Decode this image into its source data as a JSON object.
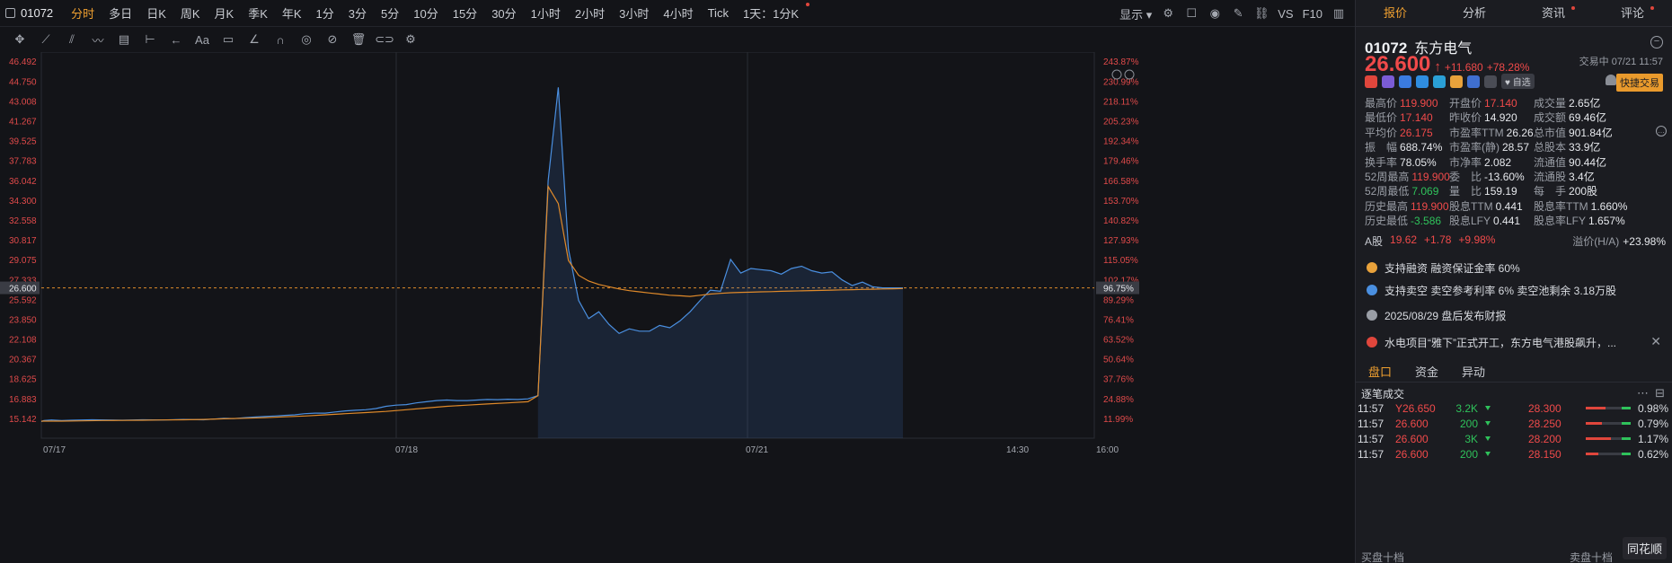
{
  "topbar": {
    "code": "01072",
    "timeframes": [
      "分时",
      "多日",
      "日K",
      "周K",
      "月K",
      "季K",
      "年K",
      "1分",
      "3分",
      "5分",
      "10分",
      "15分",
      "30分",
      "1小时",
      "2小时",
      "3小时",
      "4小时",
      "Tick",
      "1天：1分K"
    ],
    "active_index": 0,
    "display_label": "显示",
    "vs_label": "VS",
    "f10_label": "F10"
  },
  "chart_data": {
    "type": "line",
    "y_price_labels": [
      "46.492",
      "44.750",
      "43.008",
      "41.267",
      "39.525",
      "37.783",
      "36.042",
      "34.300",
      "32.558",
      "30.817",
      "29.075",
      "27.333",
      "26.600",
      "25.592",
      "23.850",
      "22.108",
      "20.367",
      "18.625",
      "16.883",
      "15.142"
    ],
    "y_pct_labels": [
      "243.87%",
      "230.99%",
      "218.11%",
      "205.23%",
      "192.34%",
      "179.46%",
      "166.58%",
      "153.70%",
      "140.82%",
      "127.93%",
      "115.05%",
      "102.17%",
      "96.75%",
      "89.29%",
      "76.41%",
      "63.52%",
      "50.64%",
      "37.76%",
      "24.88%",
      "11.99%"
    ],
    "x_labels": [
      "07/17",
      "07/18",
      "07/21",
      "14:30",
      "16:00"
    ],
    "ylim": [
      13.4,
      47.3
    ],
    "last_price": 26.6,
    "series": [
      {
        "name": "",
        "color": "#4a8fe0",
        "x": [
          0,
          5,
          20,
          40,
          60,
          80,
          100,
          130,
          160,
          200,
          240,
          280,
          320,
          340,
          360,
          380,
          400,
          420,
          440,
          460,
          480,
          500,
          520,
          540,
          560,
          580,
          600,
          620,
          640,
          660,
          680,
          700,
          720,
          740,
          760,
          780,
          800,
          820,
          840,
          860,
          880,
          900,
          920,
          940,
          960,
          980,
          1000,
          1020,
          1040,
          1060,
          1080,
          1100,
          1120,
          1140,
          1160,
          1180,
          1200,
          1220,
          1240,
          1260,
          1280,
          1300,
          1320,
          1340,
          1360,
          1380,
          1400,
          1420,
          1440,
          1460,
          1480,
          1500,
          1520,
          1540,
          1560,
          1580,
          1600,
          1620,
          1640,
          1660,
          1680,
          1700
        ],
        "y": [
          14.85,
          14.95,
          15.0,
          14.95,
          14.98,
          15.0,
          15.02,
          15.0,
          14.98,
          15.02,
          15.0,
          15.05,
          15.02,
          15.08,
          15.15,
          15.12,
          15.2,
          15.25,
          15.3,
          15.35,
          15.4,
          15.45,
          15.55,
          15.6,
          15.6,
          15.7,
          15.8,
          15.85,
          15.9,
          16.0,
          16.2,
          16.3,
          16.35,
          16.5,
          16.6,
          16.7,
          16.75,
          16.7,
          16.7,
          16.75,
          16.8,
          16.78,
          16.82,
          16.8,
          16.85,
          17.14,
          36.0,
          44.2,
          30.0,
          25.5,
          23.9,
          24.5,
          23.4,
          22.6,
          23.0,
          22.8,
          22.8,
          23.3,
          23.1,
          23.7,
          24.5,
          25.5,
          26.4,
          26.3,
          29.1,
          27.9,
          28.3,
          28.2,
          28.1,
          27.8,
          28.3,
          28.5,
          28.1,
          27.9,
          28.0,
          27.3,
          26.8,
          27.1,
          26.7,
          26.6,
          26.6,
          26.6
        ]
      },
      {
        "name": "",
        "color": "#e08a2a",
        "x": [
          0,
          40,
          80,
          120,
          160,
          200,
          240,
          280,
          320,
          360,
          400,
          440,
          480,
          520,
          560,
          600,
          640,
          680,
          720,
          760,
          800,
          840,
          880,
          920,
          960,
          980,
          1000,
          1020,
          1040,
          1060,
          1080,
          1100,
          1120,
          1140,
          1160,
          1180,
          1200,
          1220,
          1240,
          1260,
          1280,
          1300,
          1320,
          1340,
          1360,
          1380,
          1400,
          1420,
          1440,
          1460,
          1480,
          1500,
          1520,
          1540,
          1560,
          1580,
          1600,
          1620,
          1640,
          1660,
          1680,
          1700
        ],
        "y": [
          14.9,
          14.9,
          14.92,
          14.95,
          14.96,
          14.98,
          15.0,
          15.02,
          15.05,
          15.1,
          15.15,
          15.2,
          15.28,
          15.35,
          15.45,
          15.55,
          15.65,
          15.75,
          15.9,
          16.05,
          16.2,
          16.3,
          16.4,
          16.5,
          16.6,
          17.14,
          35.5,
          34.0,
          29.0,
          27.7,
          27.2,
          26.9,
          26.7,
          26.5,
          26.35,
          26.25,
          26.15,
          26.05,
          25.95,
          25.9,
          25.85,
          25.95,
          26.05,
          26.12,
          26.17,
          26.2,
          26.22,
          26.25,
          26.27,
          26.3,
          26.32,
          26.34,
          26.36,
          26.38,
          26.4,
          26.42,
          26.44,
          26.46,
          26.48,
          26.5,
          26.52,
          26.54
        ]
      }
    ]
  },
  "quote": {
    "code": "01072",
    "name": "东方电气",
    "price": "26.600",
    "arrow": "↑",
    "change": "+11.680",
    "change_pct": "+78.28%",
    "trade_time": "交易中 07/21 11:57",
    "watch_label": "自选",
    "fast_trade": "快捷交易"
  },
  "right_tabs": [
    "报价",
    "分析",
    "资讯",
    "评论"
  ],
  "stats": [
    {
      "k": "最高价",
      "v": "119.900",
      "c": "red"
    },
    {
      "k": "开盘价",
      "v": "17.140",
      "c": "red"
    },
    {
      "k": "成交量",
      "v": "2.65亿",
      "c": ""
    },
    {
      "k": "最低价",
      "v": "17.140",
      "c": "red"
    },
    {
      "k": "昨收价",
      "v": "14.920",
      "c": ""
    },
    {
      "k": "成交额",
      "v": "69.46亿",
      "c": ""
    },
    {
      "k": "平均价",
      "v": "26.175",
      "c": "red"
    },
    {
      "k": "市盈率TTM",
      "v": "26.26",
      "c": ""
    },
    {
      "k": "总市值",
      "v": "901.84亿",
      "c": ""
    },
    {
      "k": "振　幅",
      "v": "688.74%",
      "c": ""
    },
    {
      "k": "市盈率(静)",
      "v": "28.57",
      "c": ""
    },
    {
      "k": "总股本",
      "v": "33.9亿",
      "c": ""
    },
    {
      "k": "换手率",
      "v": "78.05%",
      "c": ""
    },
    {
      "k": "市净率",
      "v": "2.082",
      "c": ""
    },
    {
      "k": "流通值",
      "v": "90.44亿",
      "c": ""
    },
    {
      "k": "52周最高",
      "v": "119.900",
      "c": "red"
    },
    {
      "k": "委　比",
      "v": "-13.60%",
      "c": ""
    },
    {
      "k": "流通股",
      "v": "3.4亿",
      "c": ""
    },
    {
      "k": "52周最低",
      "v": "7.069",
      "c": "green"
    },
    {
      "k": "量　比",
      "v": "159.19",
      "c": ""
    },
    {
      "k": "每　手",
      "v": "200股",
      "c": ""
    },
    {
      "k": "历史最高",
      "v": "119.900",
      "c": "red"
    },
    {
      "k": "股息TTM",
      "v": "0.441",
      "c": ""
    },
    {
      "k": "股息率TTM",
      "v": "1.660%",
      "c": ""
    },
    {
      "k": "历史最低",
      "v": "-3.586",
      "c": "green"
    },
    {
      "k": "股息LFY",
      "v": "0.441",
      "c": ""
    },
    {
      "k": "股息率LFY",
      "v": "1.657%",
      "c": ""
    }
  ],
  "ashare": {
    "label": "A股",
    "price": "19.62",
    "chg": "+1.78",
    "pct": "+9.98%",
    "premium_label": "溢价(H/A)",
    "premium": "+23.98%"
  },
  "notices": [
    {
      "text": "支持融资  融资保证金率 60%",
      "color": "#e9a23b"
    },
    {
      "text": "支持卖空  卖空参考利率 6%  卖空池剩余 3.18万股",
      "color": "#4a8fe0"
    },
    {
      "text": "2025/08/29  盘后发布财报",
      "color": "#9a9ea6"
    },
    {
      "text": "水电项目“雅下”正式开工，东方电气港股飙升，...",
      "color": "#e0463c"
    }
  ],
  "bottom_tabs": [
    "盘口",
    "资金",
    "异动"
  ],
  "trades_title": "逐笔成交",
  "trades": [
    {
      "t": "11:57",
      "p": "Y26.650",
      "v": "3.2K"
    },
    {
      "t": "11:57",
      "p": "26.600",
      "v": "200"
    },
    {
      "t": "11:57",
      "p": "26.600",
      "v": "3K"
    },
    {
      "t": "11:57",
      "p": "26.600",
      "v": "200"
    }
  ],
  "depth": [
    {
      "p": "28.300",
      "pct": "0.98%",
      "fill": 0.55
    },
    {
      "p": "28.250",
      "pct": "0.79%",
      "fill": 0.45
    },
    {
      "p": "28.200",
      "pct": "1.17%",
      "fill": 0.7
    },
    {
      "p": "28.150",
      "pct": "0.62%",
      "fill": 0.35
    }
  ],
  "bottom_labels": {
    "buy": "买盘十档",
    "sell": "卖盘十档"
  },
  "logo": "同花顺"
}
